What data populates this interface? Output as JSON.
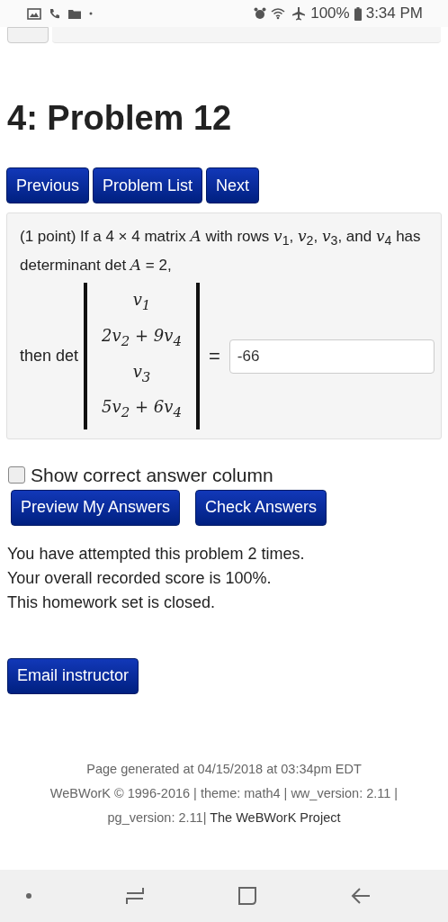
{
  "status_bar": {
    "battery": "100%",
    "time": "3:34 PM"
  },
  "title": "4: Problem 12",
  "nav_buttons": [
    "Previous",
    "Problem List",
    "Next"
  ],
  "problem": {
    "intro": "(1 point) If a 4 × 4 matrix *A* with rows *v*$_{1}$, *v*$_{2}$, *v*$_{3}$, and *v*$_{4}$ has determinant det *A* = 2,",
    "lead": "then det",
    "matrix_rows": [
      "v$_{1}$",
      "2v$_{2}$ + 9v$_{4}$",
      "v$_{3}$",
      "5v$_{2}$ + 6v$_{4}$"
    ],
    "equals": "=",
    "answer": "-66"
  },
  "show_correct": {
    "label": "Show correct answer column",
    "checked": false
  },
  "action_buttons": [
    "Preview My Answers",
    "Check Answers"
  ],
  "messages": [
    "You have attempted this problem 2 times.",
    "Your overall recorded score is 100%.",
    "This homework set is closed."
  ],
  "email_button": "Email instructor",
  "footer": {
    "generated": "Page generated at 04/15/2018 at 03:34pm EDT",
    "copyright": "WeBWorK © 1996-2016 | theme: math4 | ww_version: 2.11 | pg_version: 2.11|",
    "link": "The WeBWorK Project"
  }
}
